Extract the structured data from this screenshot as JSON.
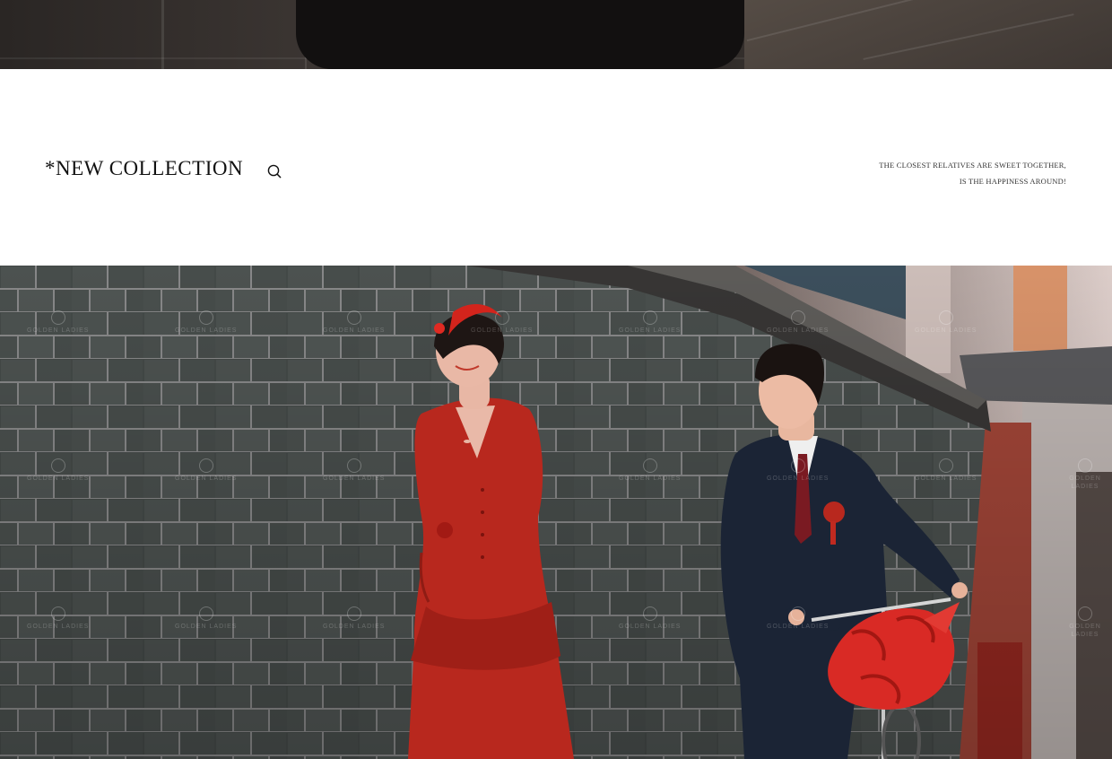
{
  "header": {
    "title": "*NEW COLLECTION",
    "tagline_line1": "THE CLOSEST RELATIVES ARE SWEET TOGETHER,",
    "tagline_line2": "IS THE HAPPINESS AROUND!"
  },
  "search": {
    "icon": "search-icon"
  },
  "watermark": {
    "text": "GOLDEN LADIES"
  },
  "colors": {
    "title": "#111111",
    "tagline": "#333333",
    "dress_red": "#b8281e",
    "suit_navy": "#1a2233",
    "brick_wall": "#4a4f4d"
  }
}
